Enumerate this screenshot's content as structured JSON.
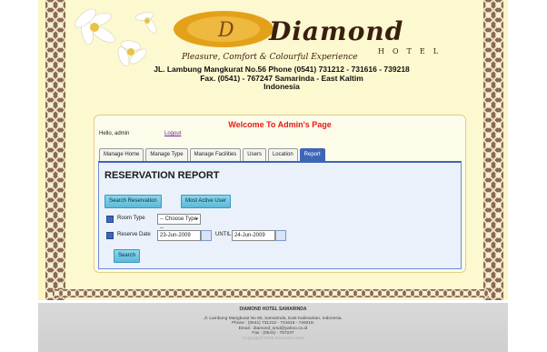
{
  "header": {
    "logo_main": "Diamond",
    "logo_sub": "HOTEL",
    "tagline": "Pleasure, Comfort & Colourful Experience",
    "address_line1": "JL. Lambung Mangkurat No.56 Phone (0541) 731212 - 731616 - 739218",
    "address_line2": "Fax. (0541) - 767247   Samarinda - East Kaltim",
    "address_line3": "Indonesia"
  },
  "panel": {
    "welcome": "Welcome To Admin's Page",
    "hello": "Hello, admin",
    "logout": "Logout"
  },
  "tabs": [
    {
      "label": "Manage Home"
    },
    {
      "label": "Manage Type"
    },
    {
      "label": "Manage Facilities"
    },
    {
      "label": "Users"
    },
    {
      "label": "Location"
    },
    {
      "label": "Report"
    }
  ],
  "report": {
    "title": "RESERVATION REPORT",
    "btn_search_reservation": "Search Reservation",
    "btn_most_active_user": "Most Active User",
    "room_type_label": "Room Type",
    "room_type_value": "-- Choose Type --",
    "reserve_date_label": "Reserve Date",
    "date_from": "23-Jun-2009",
    "until_label": "UNTIL",
    "date_to": "24-Jun-2009",
    "search_button": "Search"
  },
  "footer": {
    "title": "DIAMOND HOTEL SAMARINDA",
    "line1": "Jl. Lambung Mangkurat No 56, Samarinda, East Kalimantan, Indonesia.",
    "line2": "Phone : (0541) 731212 - 731616 - 749218.",
    "line3": "Email : diamond_smd@yahoo.co.id",
    "line4": "Fax : (0541) - 767247",
    "copyright": "Copyright©2009 Diamond Hotel"
  },
  "colors": {
    "accent_tab": "#3e66b8",
    "welcome_red": "#e41b1b",
    "page_bg": "#fbf6c6"
  }
}
